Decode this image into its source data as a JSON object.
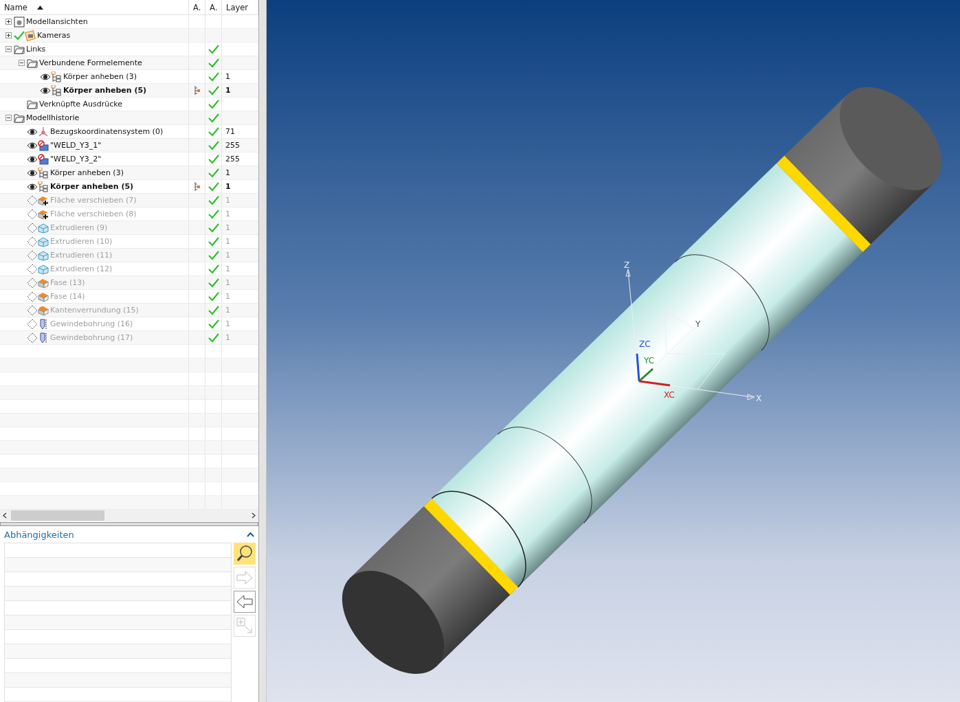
{
  "tree": {
    "columns": [
      {
        "label": "Name",
        "sorted": true
      },
      {
        "label": "A."
      },
      {
        "label": "A."
      },
      {
        "label": "Layer"
      }
    ],
    "items": [
      {
        "label": "Modellansichten",
        "kind": "views",
        "expanded": false,
        "current": false,
        "suppressed": false,
        "dependency": false,
        "checked": false
      },
      {
        "label": "Kameras",
        "kind": "cameras",
        "toggle": {
          "kind": "check"
        },
        "expanded": false,
        "current": false,
        "suppressed": false,
        "dependency": false,
        "checked": false
      },
      {
        "label": "Links",
        "kind": "folder",
        "expanded": true,
        "current": false,
        "suppressed": false,
        "dependency": false,
        "checked": true,
        "children": [
          {
            "label": "Verbundene Formelemente",
            "kind": "folder",
            "expanded": true,
            "current": false,
            "suppressed": false,
            "dependency": false,
            "checked": true,
            "children": [
              {
                "label": "Körper anheben (3)",
                "kind": "lift",
                "toggle": {
                  "kind": "eye"
                },
                "current": false,
                "suppressed": false,
                "dependency": false,
                "checked": true,
                "layer": "1"
              },
              {
                "label": "Körper anheben (5)",
                "kind": "lift",
                "toggle": {
                  "kind": "eye"
                },
                "current": true,
                "suppressed": false,
                "dependency": true,
                "checked": true,
                "layer": "1"
              }
            ]
          },
          {
            "label": "Verknüpfte Ausdrücke",
            "kind": "folder",
            "current": false,
            "suppressed": false,
            "dependency": false,
            "checked": true
          }
        ]
      },
      {
        "label": "Modellhistorie",
        "kind": "folder",
        "expanded": true,
        "current": false,
        "suppressed": false,
        "dependency": false,
        "checked": true,
        "children": [
          {
            "label": "Bezugskoordinatensystem (0)",
            "kind": "csys",
            "toggle": {
              "kind": "eye"
            },
            "current": false,
            "suppressed": false,
            "dependency": false,
            "checked": true,
            "layer": "71"
          },
          {
            "label": "\"WELD_Y3_1\"",
            "kind": "weld",
            "toggle": {
              "kind": "eye"
            },
            "current": false,
            "suppressed": false,
            "dependency": false,
            "checked": true,
            "layer": "255"
          },
          {
            "label": "\"WELD_Y3_2\"",
            "kind": "weld",
            "toggle": {
              "kind": "eye"
            },
            "current": false,
            "suppressed": false,
            "dependency": false,
            "checked": true,
            "layer": "255"
          },
          {
            "label": "Körper anheben (3)",
            "kind": "lift",
            "toggle": {
              "kind": "eye"
            },
            "current": false,
            "suppressed": false,
            "dependency": false,
            "checked": true,
            "layer": "1"
          },
          {
            "label": "Körper anheben (5)",
            "kind": "lift",
            "toggle": {
              "kind": "eye"
            },
            "current": true,
            "suppressed": false,
            "dependency": true,
            "checked": true,
            "layer": "1"
          },
          {
            "label": "Fläche verschieben (7)",
            "kind": "move",
            "toggle": {
              "kind": "dotted"
            },
            "current": false,
            "suppressed": true,
            "dependency": false,
            "checked": true,
            "layer": "1"
          },
          {
            "label": "Fläche verschieben (8)",
            "kind": "move",
            "toggle": {
              "kind": "dotted"
            },
            "current": false,
            "suppressed": true,
            "dependency": false,
            "checked": true,
            "layer": "1"
          },
          {
            "label": "Extrudieren (9)",
            "kind": "extrude",
            "toggle": {
              "kind": "dotted"
            },
            "current": false,
            "suppressed": true,
            "dependency": false,
            "checked": true,
            "layer": "1"
          },
          {
            "label": "Extrudieren (10)",
            "kind": "extrude",
            "toggle": {
              "kind": "dotted"
            },
            "current": false,
            "suppressed": true,
            "dependency": false,
            "checked": true,
            "layer": "1"
          },
          {
            "label": "Extrudieren (11)",
            "kind": "extrude",
            "toggle": {
              "kind": "dotted"
            },
            "current": false,
            "suppressed": true,
            "dependency": false,
            "checked": true,
            "layer": "1"
          },
          {
            "label": "Extrudieren (12)",
            "kind": "extrude",
            "toggle": {
              "kind": "dotted"
            },
            "current": false,
            "suppressed": true,
            "dependency": false,
            "checked": true,
            "layer": "1"
          },
          {
            "label": "Fase (13)",
            "kind": "chamfer",
            "toggle": {
              "kind": "dotted"
            },
            "current": false,
            "suppressed": true,
            "dependency": false,
            "checked": true,
            "layer": "1"
          },
          {
            "label": "Fase (14)",
            "kind": "chamfer",
            "toggle": {
              "kind": "dotted"
            },
            "current": false,
            "suppressed": true,
            "dependency": false,
            "checked": true,
            "layer": "1"
          },
          {
            "label": "Kantenverrundung (15)",
            "kind": "blend",
            "toggle": {
              "kind": "dotted"
            },
            "current": false,
            "suppressed": true,
            "dependency": false,
            "checked": true,
            "layer": "1"
          },
          {
            "label": "Gewindebohrung (16)",
            "kind": "hole",
            "toggle": {
              "kind": "dotted"
            },
            "current": false,
            "suppressed": true,
            "dependency": false,
            "checked": true,
            "layer": "1"
          },
          {
            "label": "Gewindebohrung (17)",
            "kind": "hole",
            "toggle": {
              "kind": "dotted"
            },
            "current": false,
            "suppressed": true,
            "dependency": false,
            "checked": true,
            "layer": "1"
          }
        ]
      }
    ]
  },
  "dependencies": {
    "title": "Abhängigkeiten",
    "expanded": true,
    "buttons": [
      {
        "kind": "search",
        "selected": true,
        "disabled": false
      },
      {
        "kind": "forward",
        "selected": false,
        "disabled": true
      },
      {
        "kind": "back",
        "selected": false,
        "disabled": false
      },
      {
        "kind": "expand",
        "selected": false,
        "disabled": true
      }
    ]
  },
  "viewport": {
    "axis_labels": [
      {
        "kind": "z",
        "text": "Z"
      },
      {
        "kind": "y",
        "text": "Y"
      },
      {
        "kind": "zc",
        "text": "ZC"
      },
      {
        "kind": "yc",
        "text": "YC"
      },
      {
        "kind": "xc",
        "text": "XC"
      },
      {
        "kind": "x",
        "text": "X"
      }
    ]
  }
}
